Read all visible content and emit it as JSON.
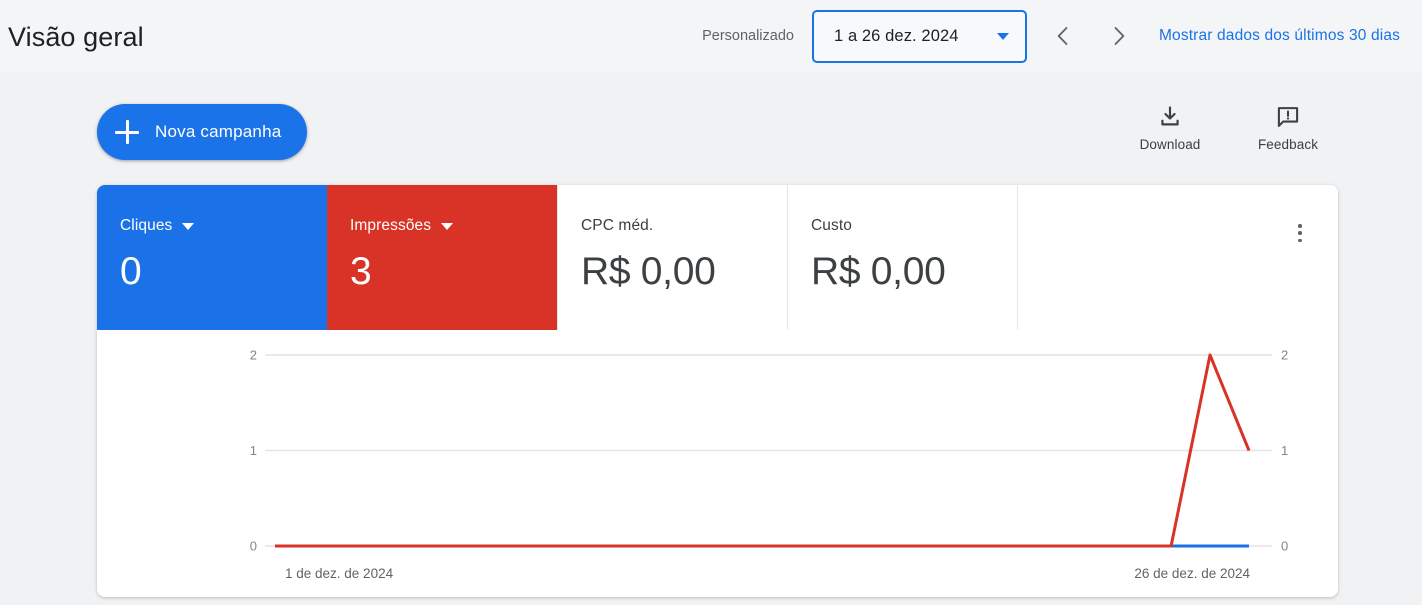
{
  "header": {
    "title": "Visão geral",
    "preset_label": "Personalizado",
    "date_range_value": "1 a 26 dez. 2024",
    "prev_icon": "chevron-left-icon",
    "next_icon": "chevron-right-icon",
    "last_30_days_link": "Mostrar dados dos últimos 30 dias"
  },
  "actions": {
    "new_campaign_label": "Nova campanha",
    "plus_icon": "plus-icon",
    "download_label": "Download",
    "download_icon": "download-icon",
    "feedback_label": "Feedback",
    "feedback_icon": "feedback-icon",
    "card_menu_icon": "more-vert-icon"
  },
  "metrics": [
    {
      "label": "Cliques",
      "value": "0",
      "color": "#1b72e8",
      "has_caret": true,
      "style": "filled"
    },
    {
      "label": "Impressões",
      "value": "3",
      "color": "#d93327",
      "has_caret": true,
      "style": "filled"
    },
    {
      "label": "CPC méd.",
      "value": "R$ 0,00",
      "color": "#ffffff",
      "has_caret": false,
      "style": "plain"
    },
    {
      "label": "Custo",
      "value": "R$ 0,00",
      "color": "#ffffff",
      "has_caret": false,
      "style": "plain"
    }
  ],
  "chart_data": {
    "type": "line",
    "title": "",
    "xlabel": "",
    "ylabel": "",
    "grid": true,
    "legend_position": "none",
    "x_tick_labels": [
      "1 de dez. de 2024",
      "26 de dez. de 2024"
    ],
    "y_tick_labels_left": [
      "0",
      "1",
      "2"
    ],
    "y_tick_labels_right": [
      "0",
      "1",
      "2"
    ],
    "ylim": [
      0,
      2
    ],
    "x": [
      "1 de dez. de 2024",
      "2 de dez. de 2024",
      "3 de dez. de 2024",
      "4 de dez. de 2024",
      "5 de dez. de 2024",
      "6 de dez. de 2024",
      "7 de dez. de 2024",
      "8 de dez. de 2024",
      "9 de dez. de 2024",
      "10 de dez. de 2024",
      "11 de dez. de 2024",
      "12 de dez. de 2024",
      "13 de dez. de 2024",
      "14 de dez. de 2024",
      "15 de dez. de 2024",
      "16 de dez. de 2024",
      "17 de dez. de 2024",
      "18 de dez. de 2024",
      "19 de dez. de 2024",
      "20 de dez. de 2024",
      "21 de dez. de 2024",
      "22 de dez. de 2024",
      "23 de dez. de 2024",
      "24 de dez. de 2024",
      "25 de dez. de 2024",
      "26 de dez. de 2024"
    ],
    "series": [
      {
        "name": "Impressões",
        "color": "#d93327",
        "axis": "left",
        "values": [
          0,
          0,
          0,
          0,
          0,
          0,
          0,
          0,
          0,
          0,
          0,
          0,
          0,
          0,
          0,
          0,
          0,
          0,
          0,
          0,
          0,
          0,
          0,
          0,
          2,
          1
        ]
      },
      {
        "name": "Cliques",
        "color": "#1b72e8",
        "axis": "right",
        "values": [
          0,
          0,
          0,
          0,
          0,
          0,
          0,
          0,
          0,
          0,
          0,
          0,
          0,
          0,
          0,
          0,
          0,
          0,
          0,
          0,
          0,
          0,
          0,
          0,
          0,
          0
        ]
      }
    ]
  }
}
